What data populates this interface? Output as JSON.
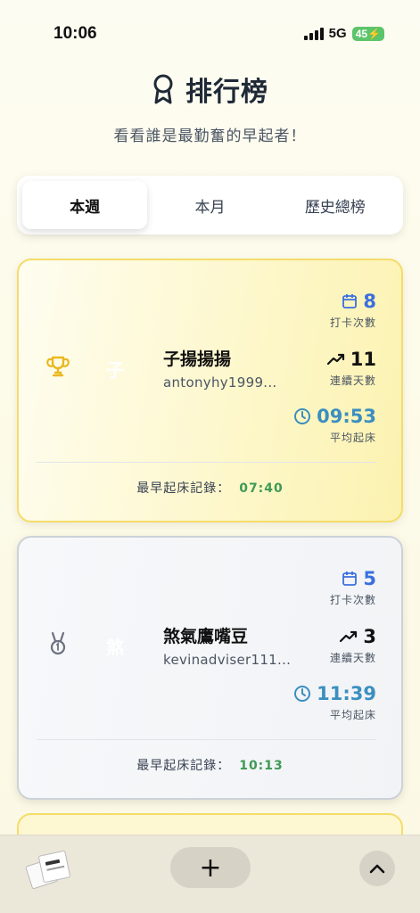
{
  "status_bar": {
    "time": "10:06",
    "network": "5G",
    "battery": "45"
  },
  "header": {
    "title": "排行榜",
    "subtitle": "看看誰是最勤奮的早起者！",
    "icon": "ribbon-award-icon"
  },
  "tabs": [
    {
      "label": "本週",
      "active": true
    },
    {
      "label": "本月",
      "active": false
    },
    {
      "label": "歷史總榜",
      "active": false
    }
  ],
  "leaderboard": [
    {
      "rank_icon": "trophy-icon",
      "avatar_initial": "子",
      "name": "子揚揚揚",
      "user_id": "antonyhy1999...",
      "checkins": "8",
      "checkins_label": "打卡次數",
      "streak": "11",
      "streak_label": "連續天數",
      "avg_wake": "09:53",
      "avg_wake_label": "平均起床",
      "earliest_label": "最早起床記錄：",
      "earliest_time": "07:40"
    },
    {
      "rank_icon": "medal-icon",
      "avatar_initial": "煞",
      "name": "煞氣鷹嘴豆",
      "user_id": "kevinadviser111...",
      "checkins": "5",
      "checkins_label": "打卡次數",
      "streak": "3",
      "streak_label": "連續天數",
      "avg_wake": "11:39",
      "avg_wake_label": "平均起床",
      "earliest_label": "最早起床記錄：",
      "earliest_time": "10:13"
    }
  ],
  "bottom_bar": {
    "add_label": "+"
  },
  "colors": {
    "gold_border": "#f5dc6a",
    "silver_border": "#cdd2d8",
    "accent_blue": "#3b6fe0",
    "accent_teal": "#3b8fc0",
    "accent_green": "#3f9a55"
  }
}
